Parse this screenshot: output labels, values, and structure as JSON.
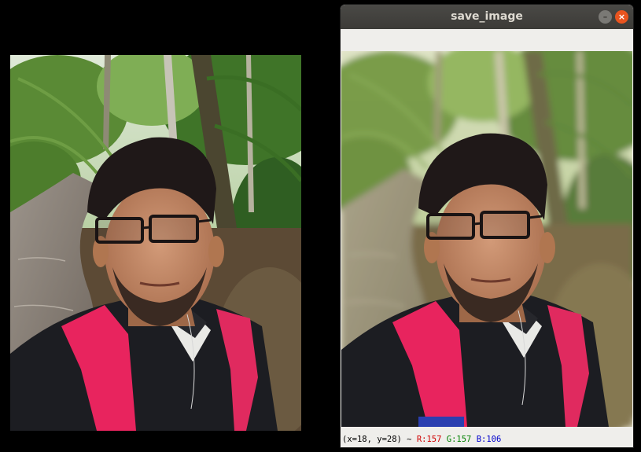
{
  "window": {
    "title": "save_image",
    "minimize_glyph": "–",
    "close_glyph": "×",
    "icons": [
      "minimize-icon",
      "close-icon"
    ]
  },
  "status": {
    "coords": "(x=18, y=28) ~ ",
    "r": "R:157",
    "g": "G:157",
    "b": "B:106"
  },
  "images": {
    "original": "selfie-original",
    "processed": "selfie-blurred-background"
  },
  "colors": {
    "desktop_bg": "#000000",
    "titlebar": "#3c3b37",
    "close_button": "#e9541f",
    "backpack": "#e8245e",
    "shirt": "#1c1d22"
  }
}
